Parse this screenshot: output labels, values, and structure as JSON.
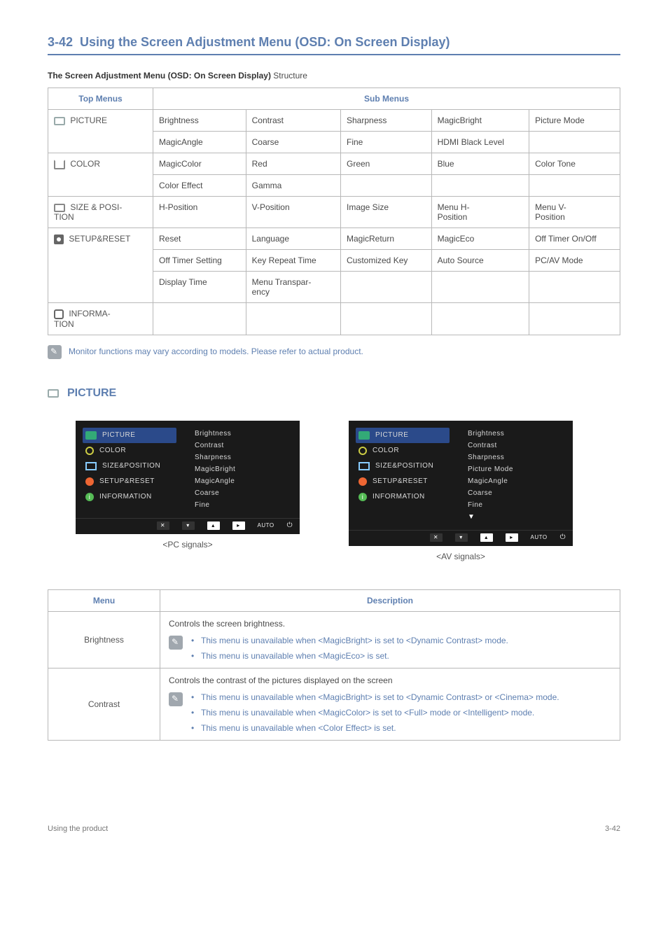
{
  "section": {
    "number": "3-42",
    "title": "Using the Screen Adjustment Menu (OSD: On Screen Display)"
  },
  "subtitle_bold": "The Screen Adjustment Menu (OSD: On Screen Display)",
  "subtitle_rest": " Structure",
  "table_headers": {
    "top": "Top Menus",
    "sub": "Sub Menus"
  },
  "rows": [
    {
      "menu": "PICTURE",
      "cells": [
        [
          "Brightness",
          "Contrast",
          "Sharpness",
          "MagicBright",
          "Picture Mode"
        ],
        [
          "MagicAngle",
          "Coarse",
          "Fine",
          "HDMI Black Level",
          ""
        ]
      ]
    },
    {
      "menu": "COLOR",
      "cells": [
        [
          "MagicColor",
          "Red",
          "Green",
          "Blue",
          "Color Tone"
        ],
        [
          "Color Effect",
          "Gamma",
          "",
          "",
          ""
        ]
      ]
    },
    {
      "menu": "SIZE & POSI-TION",
      "cells": [
        [
          "H-Position",
          "V-Position",
          "Image Size",
          "Menu H-Position",
          "Menu V-Position"
        ]
      ]
    },
    {
      "menu": "SETUP&RESET",
      "cells": [
        [
          "Reset",
          "Language",
          "MagicReturn",
          "MagicEco",
          "Off Timer On/Off"
        ],
        [
          "Off Timer Setting",
          "Key Repeat Time",
          "Customized Key",
          "Auto Source",
          "PC/AV Mode"
        ],
        [
          "Display Time",
          "Menu Transpar-ency",
          "",
          "",
          ""
        ]
      ]
    },
    {
      "menu": "INFORMA-TION",
      "cells": [
        [
          "",
          "",
          "",
          "",
          ""
        ]
      ]
    }
  ],
  "note_text": "Monitor functions may vary according to models. Please refer to actual product.",
  "picture_heading": "PICTURE",
  "osd_left_items": [
    "PICTURE",
    "COLOR",
    "SIZE&POSITION",
    "SETUP&RESET",
    "INFORMATION"
  ],
  "osd_pc_right": [
    "Brightness",
    "Contrast",
    "Sharpness",
    "MagicBright",
    "MagicAngle",
    "Coarse",
    "Fine"
  ],
  "osd_av_right": [
    "Brightness",
    "Contrast",
    "Sharpness",
    "Picture Mode",
    "MagicAngle",
    "Coarse",
    "Fine"
  ],
  "osd_bottom_auto": "AUTO",
  "pc_label": "<PC signals>",
  "av_label": "<AV signals>",
  "desc_headers": {
    "menu": "Menu",
    "desc": "Description"
  },
  "desc_rows": [
    {
      "menu": "Brightness",
      "lead": "Controls the screen brightness.",
      "notes": [
        "This menu is unavailable when <MagicBright> is set to <Dynamic Contrast> mode.",
        "This menu is unavailable when <MagicEco> is set."
      ]
    },
    {
      "menu": "Contrast",
      "lead": "Controls the contrast of the pictures displayed on the screen",
      "notes": [
        "This menu is unavailable when <MagicBright> is set to <Dynamic Contrast> or <Cinema> mode.",
        "This menu is unavailable when <MagicColor> is set to <Full> mode or <Intelligent> mode.",
        "This menu is unavailable when <Color Effect> is set."
      ]
    }
  ],
  "footer": {
    "left": "Using the product",
    "right": "3-42"
  }
}
